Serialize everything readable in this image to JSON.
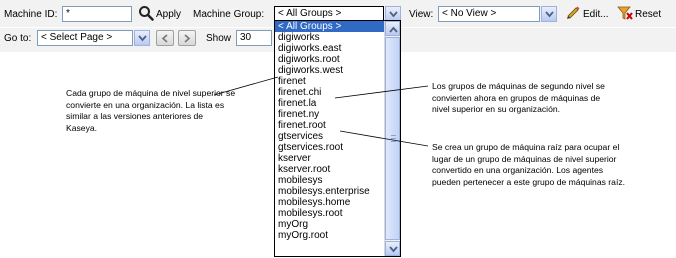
{
  "toolbar": {
    "machine_id_label": "Machine ID:",
    "machine_id_value": "*",
    "apply_label": "Apply",
    "machine_group_label": "Machine Group:",
    "machine_group_value": "< All Groups >",
    "view_label": "View:",
    "view_value": "< No View >",
    "edit_label": "Edit...",
    "reset_label": "Reset",
    "goto_label": "Go to:",
    "goto_value": "< Select Page >",
    "show_label": "Show",
    "show_value": "30"
  },
  "dropdown": {
    "options": [
      "< All Groups >",
      "digiworks",
      "digiworks.east",
      "digiworks.root",
      "digiworks.west",
      "firenet",
      "firenet.chi",
      "firenet.la",
      "firenet.ny",
      "firenet.root",
      "gtservices",
      "gtservices.root",
      "kserver",
      "kserver.root",
      "mobilesys",
      "mobilesys.enterprise",
      "mobilesys.home",
      "mobilesys.root",
      "myOrg",
      "myOrg.root"
    ],
    "selected_index": 0
  },
  "annotations": {
    "left": "Cada grupo de máquina de nivel superior se convierte en una organización. La lista es similar a las versiones anteriores de Kaseya.",
    "right_top": "Los grupos de máquinas de segundo nivel se convierten ahora en grupos de máquinas de nivel superior en su organización.",
    "right_bottom": "Se crea un grupo de máquina raíz para ocupar el lugar de un grupo de máquinas de nivel superior convertido en una organización. Los agentes pueden pertenecer a este grupo de máquinas raíz."
  },
  "colors": {
    "toolbar_bg": "#f2f2f2",
    "selected_bg": "#316ac5",
    "selected_fg": "#ffffff"
  }
}
